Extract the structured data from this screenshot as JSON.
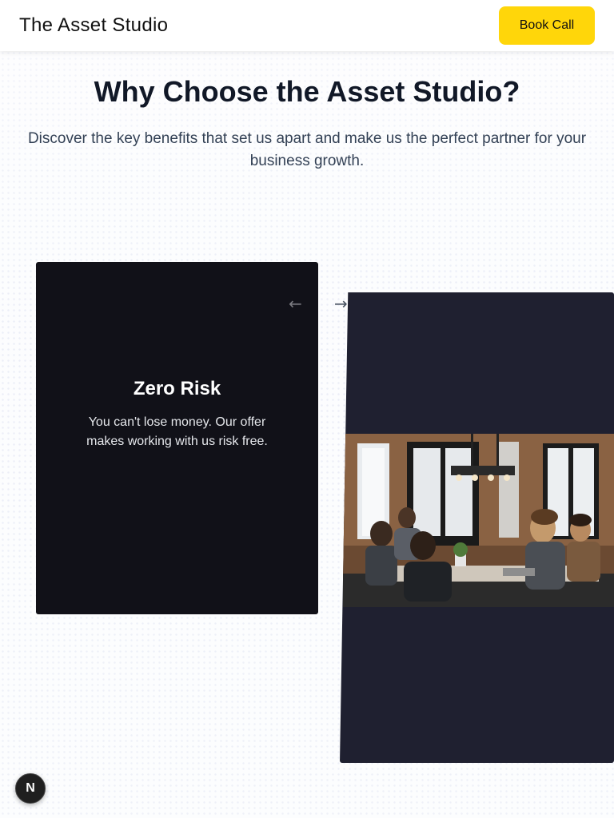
{
  "header": {
    "brand": "The Asset Studio",
    "book_call_label": "Book Call"
  },
  "hero": {
    "title": "Why Choose the Asset Studio?",
    "subtitle": "Discover the key benefits that set us apart and make us the perfect partner for your business growth."
  },
  "carousel": {
    "prev_icon": "←",
    "next_icon": "→",
    "active_card": {
      "title": "Zero Risk",
      "text": "You can't lose money. Our offer makes working with us risk free."
    }
  },
  "badge": {
    "letter": "N"
  },
  "colors": {
    "accent": "#ffd60a",
    "card_dark": "#111118",
    "card_back": "#1f2030"
  }
}
